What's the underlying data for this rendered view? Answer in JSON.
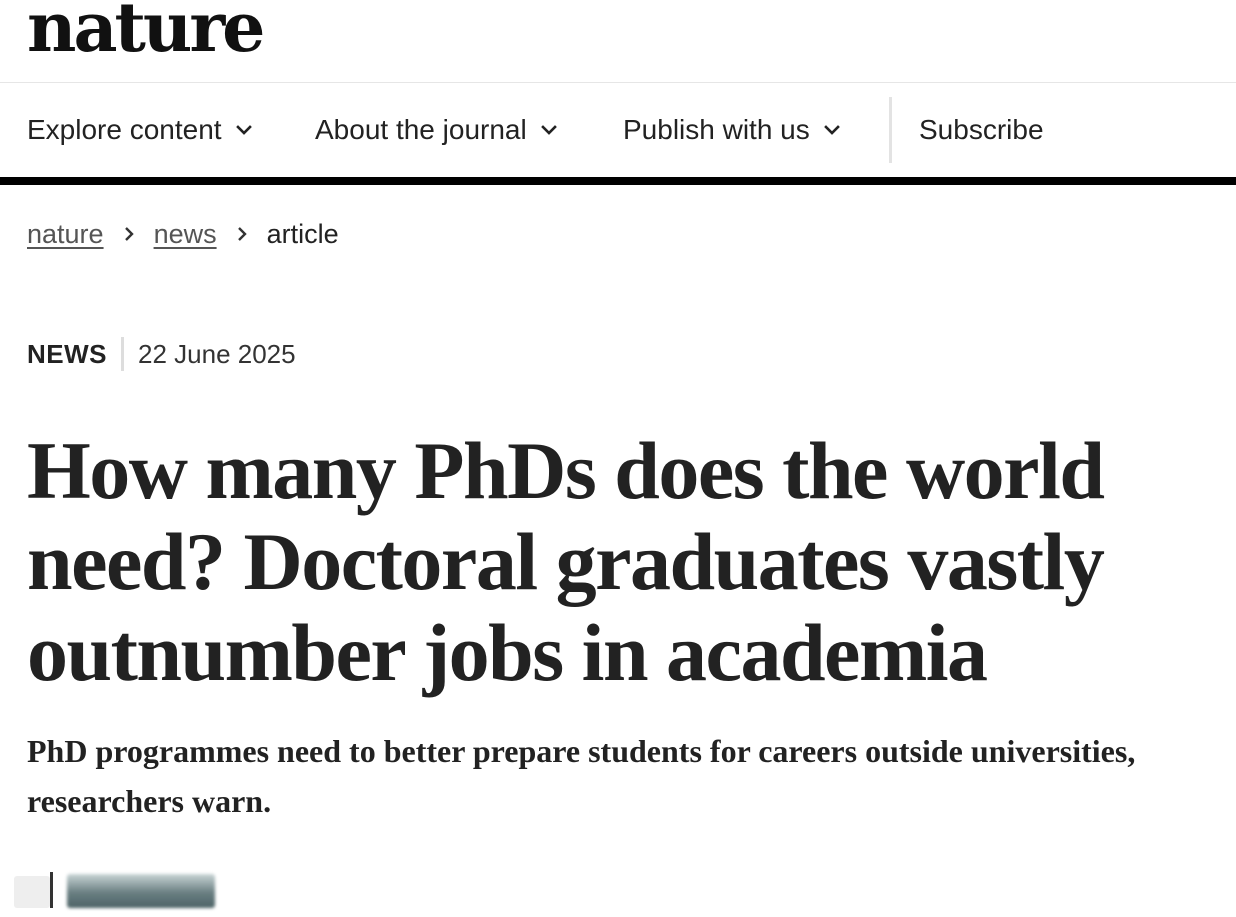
{
  "site": {
    "logo": "nature"
  },
  "nav": {
    "items": [
      {
        "label": "Explore content",
        "has_dropdown": true,
        "icon": "chevron-down-icon"
      },
      {
        "label": "About the journal",
        "has_dropdown": true,
        "icon": "chevron-down-icon"
      },
      {
        "label": "Publish with us",
        "has_dropdown": true,
        "icon": "chevron-down-icon"
      },
      {
        "label": "Subscribe",
        "has_dropdown": false
      }
    ]
  },
  "breadcrumb": {
    "items": [
      {
        "label": "nature",
        "link": true
      },
      {
        "label": "news",
        "link": true
      },
      {
        "label": "article",
        "link": false
      }
    ],
    "separator_icon": "chevron-right-icon"
  },
  "article": {
    "type": "NEWS",
    "date": "22 June 2025",
    "title": "How many PhDs does the world need? Doctoral graduates vastly outnumber jobs in academia",
    "standfirst": "PhD programmes need to better prepare students for careers outside universities, researchers warn."
  },
  "colors": {
    "text": "#222222",
    "muted_link": "#555555",
    "rule": "#000000",
    "divider": "#e3e3e3"
  }
}
